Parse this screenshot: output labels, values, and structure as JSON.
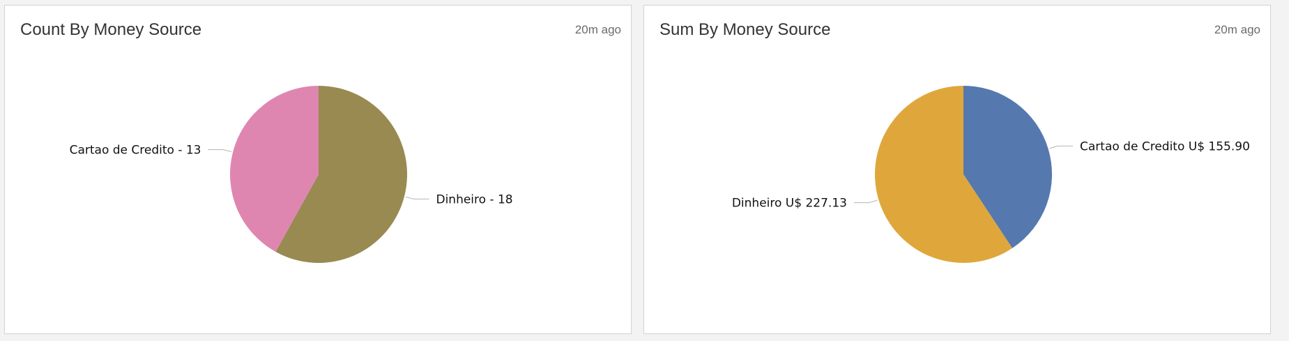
{
  "panels": [
    {
      "title": "Count By Money Source",
      "time": "20m ago"
    },
    {
      "title": "Sum By Money Source",
      "time": "20m ago"
    }
  ],
  "chart_data": [
    {
      "type": "pie",
      "title": "Count By Money Source",
      "categories": [
        "Dinheiro",
        "Cartao de Credito"
      ],
      "values": [
        18,
        13
      ],
      "labels": [
        "Dinheiro - 18",
        "Cartao de Credito - 13"
      ],
      "colors": [
        "#988a51",
        "#de86b0"
      ]
    },
    {
      "type": "pie",
      "title": "Sum By Money Source",
      "categories": [
        "Cartao de Credito",
        "Dinheiro"
      ],
      "values": [
        155.9,
        227.13
      ],
      "labels": [
        "Cartao de Credito U$ 155.90",
        "Dinheiro U$ 227.13"
      ],
      "colors": [
        "#5578af",
        "#dfa73b"
      ]
    }
  ]
}
